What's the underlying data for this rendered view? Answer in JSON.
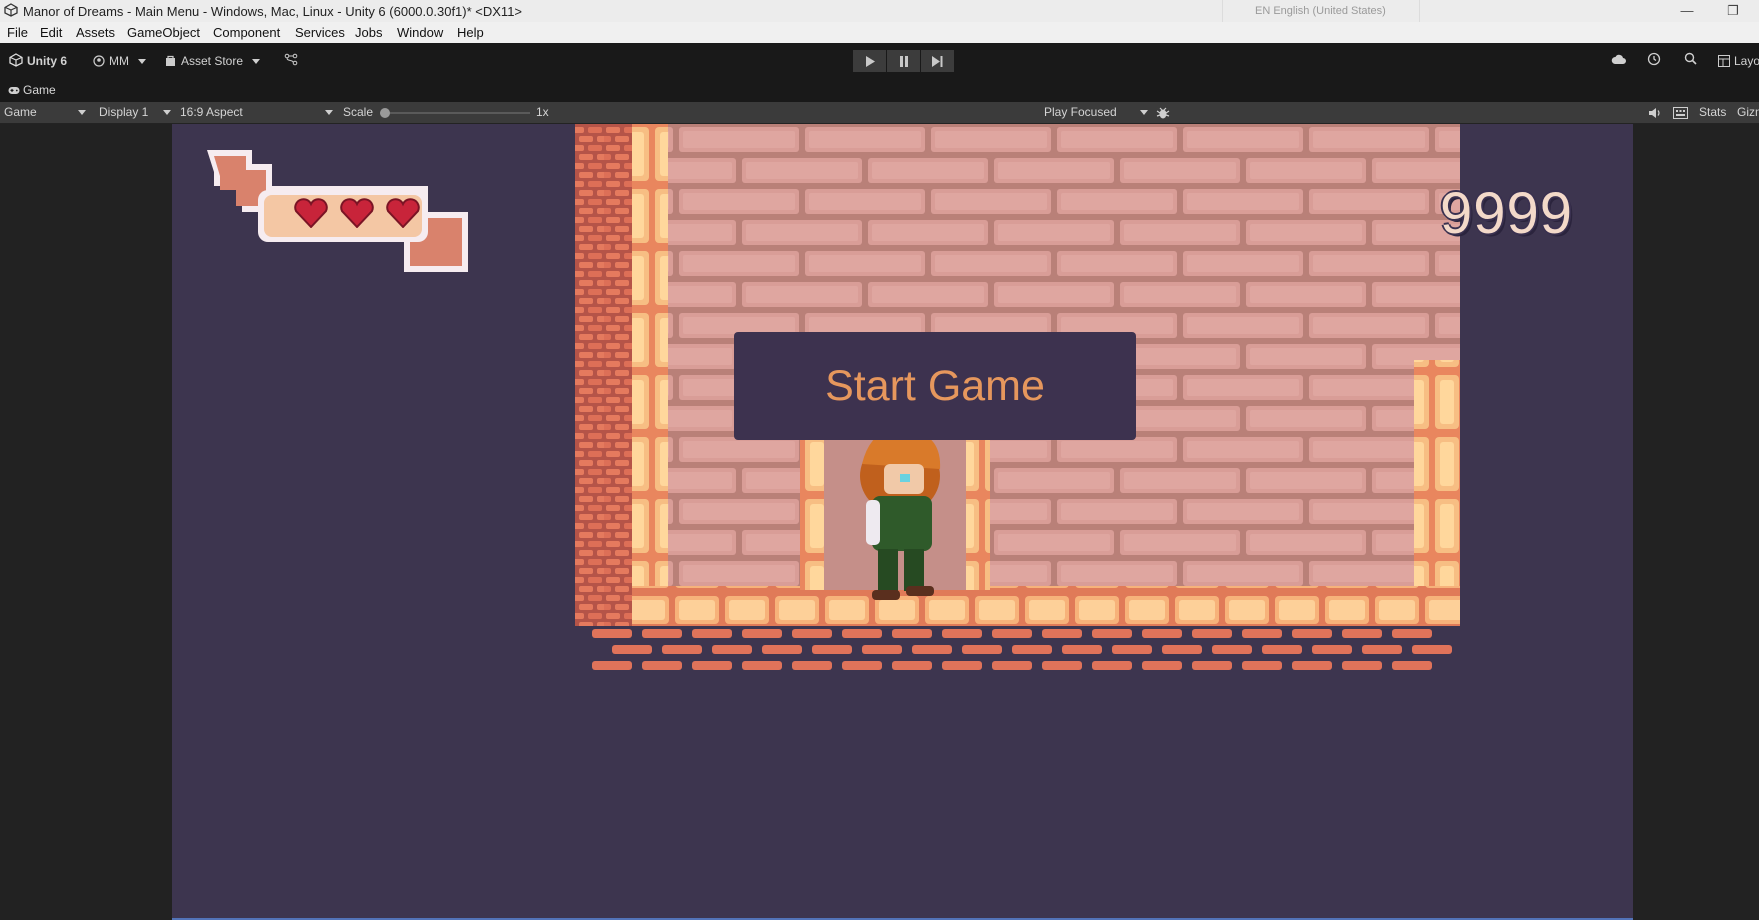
{
  "window": {
    "title": "Manor of Dreams - Main Menu - Windows, Mac, Linux - Unity 6 (6000.0.30f1)* <DX11>",
    "language": "EN English (United States)"
  },
  "menu": [
    "File",
    "Edit",
    "Assets",
    "GameObject",
    "Component",
    "Services",
    "Jobs",
    "Window",
    "Help"
  ],
  "toolbar": {
    "unity_label": "Unity 6",
    "account_label": "MM",
    "asset_store_label": "Asset Store",
    "layout_label": "Layo"
  },
  "tab": {
    "label": "Game"
  },
  "game_toolbar": {
    "mode": "Game",
    "display": "Display 1",
    "aspect": "16:9 Aspect",
    "scale_label": "Scale",
    "scale_value": "1x",
    "scale_fraction": 0.0,
    "play_mode": "Play Focused",
    "stats_label": "Stats",
    "gizmos_label": "Gizm"
  },
  "game": {
    "score": "9999",
    "hearts": 3,
    "start_button": "Start Game"
  },
  "colors": {
    "game_bg": "#3d354f",
    "brick": "#d88a88",
    "accent_text": "#e6975d",
    "heart": "#d0293a"
  },
  "icons": {
    "play": "play-icon",
    "pause": "pause-icon",
    "step": "step-icon",
    "cloud": "cloud-icon",
    "history": "history-icon",
    "search": "search-icon"
  }
}
